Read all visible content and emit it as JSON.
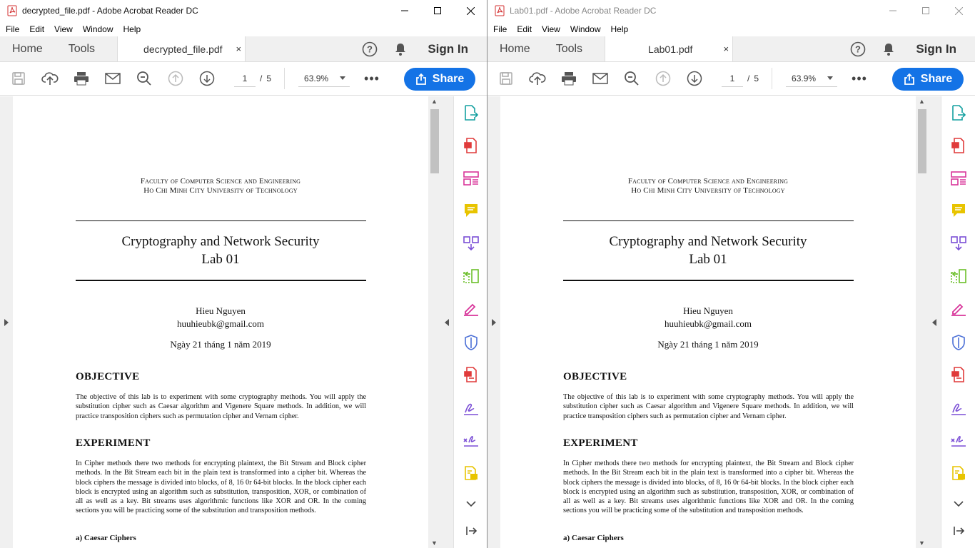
{
  "windows": [
    {
      "title": "decrypted_file.pdf - Adobe Acrobat Reader DC",
      "tab_name": "decrypted_file.pdf"
    },
    {
      "title": "Lab01.pdf - Adobe Acrobat Reader DC",
      "tab_name": "Lab01.pdf"
    }
  ],
  "menu": [
    "File",
    "Edit",
    "View",
    "Window",
    "Help"
  ],
  "nav": {
    "home": "Home",
    "tools": "Tools",
    "sign_in": "Sign In",
    "tab_close": "×"
  },
  "toolbar": {
    "page_current": "1",
    "page_sep": "/",
    "page_total": "5",
    "zoom": "63.9%",
    "more": "•••",
    "share": "Share"
  },
  "document": {
    "institution_line1": "Faculty of Computer Science and Engineering",
    "institution_line2": "Ho Chi Minh City University of Technology",
    "title_line1": "Cryptography and Network Security",
    "title_line2": "Lab 01",
    "author": "Hieu Nguyen",
    "email": "huuhieubk@gmail.com",
    "date": "Ngày 21 tháng 1 năm 2019",
    "objective_heading": "OBJECTIVE",
    "objective_text": "The objective of this lab is to experiment with some cryptography methods. You will apply the substitution cipher such as Caesar algorithm and Vigenere Square methods. In addition, we will practice transposition ciphers such as permutation cipher and Vernam cipher.",
    "experiment_heading": "EXPERIMENT",
    "experiment_text": "In Cipher methods there two methods for encrypting plaintext, the Bit Stream and Block cipher methods. In the Bit Stream each bit in the plain text is transformed into a cipher bit. Whereas the block ciphers the message is divided into blocks, of 8, 16 0r 64-bit blocks. In the block cipher each block is encrypted using an algorithm such as substitution, transposition, XOR, or combination of all as well as a key. Bit streams uses algorithmic functions like XOR and OR. In the coming sections you will be practicing some of the substitution and transposition methods.",
    "subsection": "a) Caesar Ciphers"
  },
  "icons": {
    "rail": [
      "export-pdf-icon",
      "create-pdf-icon",
      "edit-pdf-icon",
      "comment-icon",
      "combine-files-icon",
      "organize-pages-icon",
      "redact-icon",
      "protect-icon",
      "compress-pdf-icon",
      "fill-sign-icon",
      "send-for-signature-icon",
      "send-for-comments-icon",
      "chevron-down-icon",
      "collapse-panel-icon"
    ]
  },
  "colors": {
    "accent": "#1473e6",
    "teal": "#14a0a0",
    "red": "#e03b3b",
    "yellow": "#e8c400",
    "purple": "#7b4fd6",
    "green": "#6cbf2a",
    "pink": "#d8359a",
    "blue": "#4b6fd6"
  }
}
